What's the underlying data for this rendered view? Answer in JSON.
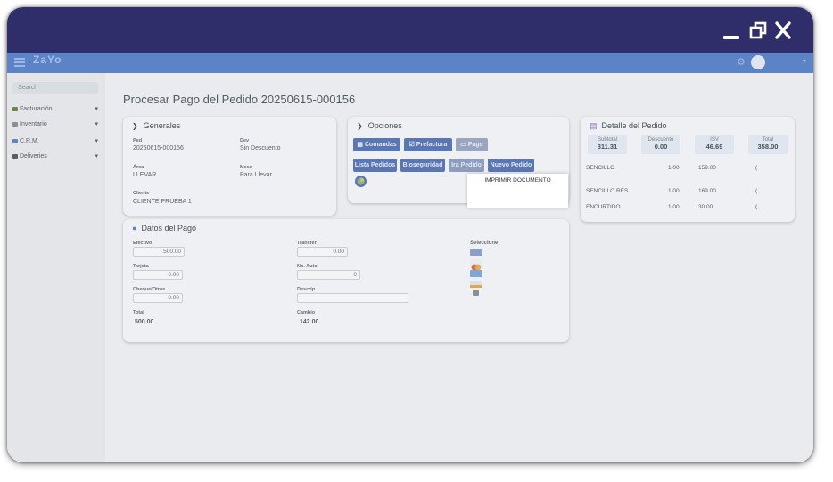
{
  "window": {
    "titlebar_color": "#2f2e6a",
    "controls": [
      "minimize-icon",
      "restore-icon",
      "close-icon"
    ]
  },
  "appnav": {
    "color": "#5b83c6",
    "logo_text": "ZaYo",
    "gear": "⚙",
    "caret": "▾"
  },
  "sidebar": {
    "search_placeholder": "Search",
    "items": [
      {
        "label": "Facturación",
        "icon_color": "#6a8a4a"
      },
      {
        "label": "Inventario",
        "icon_color": "#8a8e96"
      },
      {
        "label": "C.R.M.",
        "icon_color": "#6a82b8"
      },
      {
        "label": "Deliveries",
        "icon_color": "#5a5e66"
      }
    ],
    "caret": "▾"
  },
  "page_title": "Procesar Pago del Pedido 20250615-000156",
  "generales": {
    "title": "Generales",
    "chevron": "❯",
    "ped_label": "Ped",
    "ped_value": "20250615-000156",
    "dev_label": "Dev",
    "dev_value": "Sin Descuento",
    "area_label": "Área",
    "area_value": "LLEVAR",
    "mesa_label": "Mesa",
    "mesa_value": "Para Llevar",
    "cliente_label": "Cliente",
    "cliente_value": "CLIENTE PRUEBA 1"
  },
  "opciones": {
    "title": "Opciones",
    "chevron": "❯",
    "comandas": "Comandas",
    "prefactura": "Prefactura",
    "pago": "Pago",
    "lista_pedidos": "Lista Pedidos",
    "bioseguridad": "Bioseguridad",
    "ira_pedido": "Ira Pedido",
    "nuevo_pedido": "Nuevo Pedido",
    "tooltip": "IMPRIMIR DOCUMENTO"
  },
  "detalle": {
    "title": "Detalle del Pedido",
    "subtotal_label": "Subtotal",
    "subtotal_value": "311.31",
    "descuento_label": "Descuento",
    "descuento_value": "0.00",
    "isv_label": "ISV",
    "isv_value": "46.69",
    "total_label": "Total",
    "total_value": "358.00",
    "items": [
      {
        "name": "SENCILLO",
        "qty": "1.00",
        "price": "159.00",
        "mark": "("
      },
      {
        "name": "SENCILLO RES",
        "qty": "1.00",
        "price": "169.00",
        "mark": "("
      },
      {
        "name": "ENCURTIDO",
        "qty": "1.00",
        "price": "30.00",
        "mark": "("
      }
    ]
  },
  "pago": {
    "title": "Datos del Pago",
    "efectivo_label": "Efectivo",
    "efectivo_value": "500.00",
    "transfer_label": "Transfer",
    "transfer_value": "0.00",
    "tarjeta_label": "Tarjeta",
    "tarjeta_value": "0.00",
    "no_auto_label": "No. Auto",
    "no_auto_value": "0",
    "cheque_label": "Cheque/Otros",
    "cheque_value": "0.00",
    "descrip_label": "Descrip.",
    "descrip_value": "",
    "seleccione_label": "Seleccione:",
    "total_label": "Total",
    "total_value": "500.00",
    "cambio_label": "Cambio",
    "cambio_value": "142.00",
    "payment_icons": [
      "visa-icon",
      "mastercard-icon",
      "amex-icon",
      "discover-icon",
      "cash-grid-icon"
    ]
  }
}
